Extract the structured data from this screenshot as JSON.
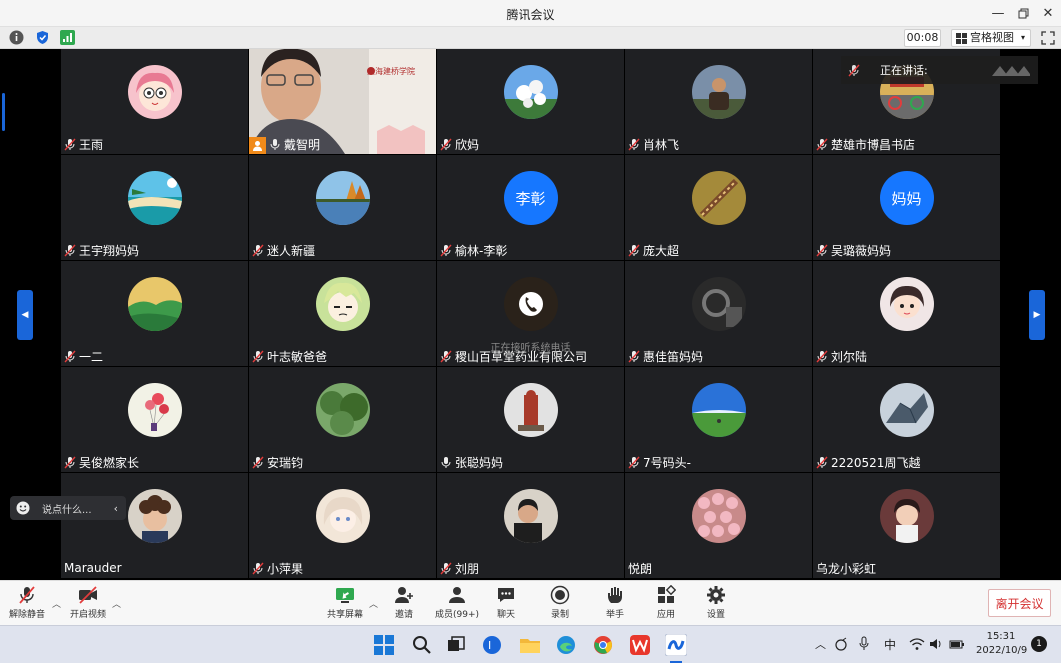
{
  "window": {
    "title": "腾讯会议"
  },
  "toolbar": {
    "timer": "00:08",
    "view_label": "宫格视图"
  },
  "speaking": {
    "label": "正在讲话:"
  },
  "chat": {
    "placeholder": "说点什么..."
  },
  "tiles": [
    {
      "name": "王雨",
      "mic": "muted",
      "avatar": "cartoon-girl"
    },
    {
      "name": "戴智明",
      "mic": "on",
      "avatar": "video",
      "host": true
    },
    {
      "name": "欣妈",
      "mic": "muted",
      "avatar": "flowers"
    },
    {
      "name": "肖林飞",
      "mic": "muted",
      "avatar": "man-photo"
    },
    {
      "name": "楚雄市博昌书店",
      "mic": "muted",
      "avatar": "bikes"
    },
    {
      "name": "王宇翔妈妈",
      "mic": "muted",
      "avatar": "beach"
    },
    {
      "name": "迷人新疆",
      "mic": "muted",
      "avatar": "lake"
    },
    {
      "name": "榆林-李彰",
      "mic": "muted",
      "avatar": "text",
      "avatar_text": "李彰"
    },
    {
      "name": "庞大超",
      "mic": "muted",
      "avatar": "bridge"
    },
    {
      "name": "吴璐薇妈妈",
      "mic": "muted",
      "avatar": "text",
      "avatar_text": "妈妈"
    },
    {
      "name": "一二",
      "mic": "muted",
      "avatar": "hills"
    },
    {
      "name": "叶志敏爸爸",
      "mic": "muted",
      "avatar": "anime-boy"
    },
    {
      "name": "稷山百草堂药业有限公司",
      "mic": "muted",
      "avatar": "phone",
      "status": "正在接听系统电话"
    },
    {
      "name": "惠佳笛妈妈",
      "mic": "muted",
      "avatar": "car-interior"
    },
    {
      "name": "刘尔陆",
      "mic": "muted",
      "avatar": "girl-photo"
    },
    {
      "name": "吴俊燃家长",
      "mic": "muted",
      "avatar": "balloons"
    },
    {
      "name": "安瑞钧",
      "mic": "muted",
      "avatar": "forest"
    },
    {
      "name": "张聪妈妈",
      "mic": "on",
      "avatar": "statue"
    },
    {
      "name": "7号码头-",
      "mic": "muted",
      "avatar": "sky-field"
    },
    {
      "name": "2220521周飞越",
      "mic": "muted",
      "avatar": "dragon"
    },
    {
      "name": "Marauder",
      "mic": "none",
      "avatar": "curly-boy"
    },
    {
      "name": "小萍果",
      "mic": "muted",
      "avatar": "anime-girl"
    },
    {
      "name": "刘朋",
      "mic": "muted",
      "avatar": "man-dark"
    },
    {
      "name": "悦朗",
      "mic": "none",
      "avatar": "pink-flowers"
    },
    {
      "name": "乌龙小彩虹",
      "mic": "none",
      "avatar": "little-girl"
    }
  ],
  "bottom": {
    "unmute": "解除静音",
    "video": "开启视频",
    "share": "共享屏幕",
    "invite": "邀请",
    "members": "成员(99+)",
    "chat": "聊天",
    "record": "录制",
    "raise_hand": "举手",
    "apps": "应用",
    "settings": "设置",
    "leave": "离开会议"
  },
  "taskbar": {
    "input_method": "中",
    "time": "15:31",
    "date": "2022/10/9",
    "notification_count": "1"
  },
  "colors": {
    "accent": "#1677ff",
    "tile_bg": "#1f2023",
    "leave_red": "#d43030"
  }
}
